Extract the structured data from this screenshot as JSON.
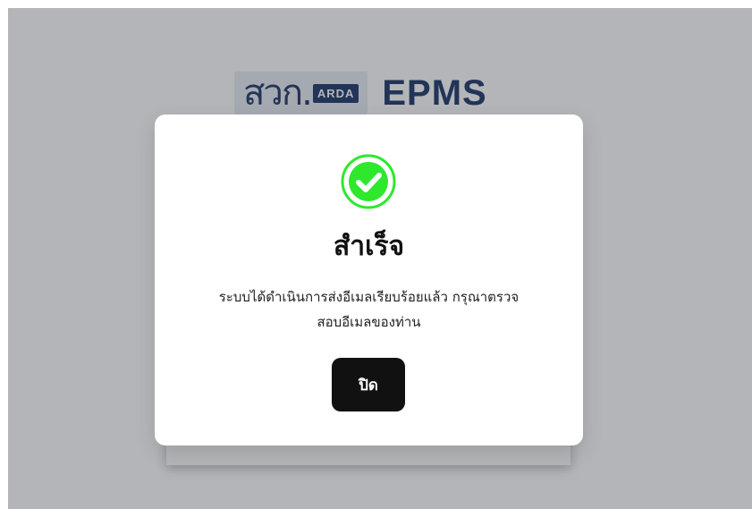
{
  "logo": {
    "thai_mark": "สวก.",
    "badge": "ARDA",
    "app_name": "EPMS"
  },
  "modal": {
    "icon": "check-circle-icon",
    "title": "สำเร็จ",
    "message_line1": "ระบบได้ดำเนินการส่งอีเมลเรียบร้อยแล้ว กรุณาตรวจ",
    "message_line2": "สอบอีเมลของท่าน",
    "close_label": "ปิด"
  },
  "colors": {
    "success": "#2ee82e",
    "button": "#111111",
    "brand": "#1f3a6b"
  }
}
